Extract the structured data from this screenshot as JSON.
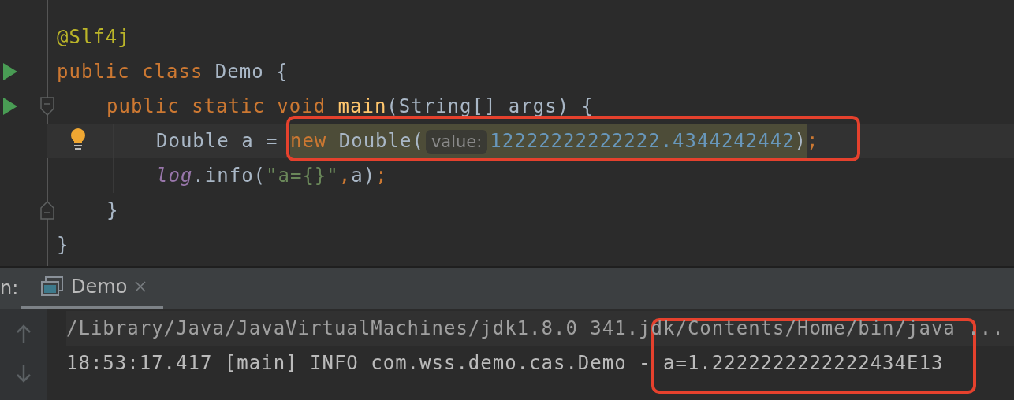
{
  "editor": {
    "lines": [
      {
        "run_marker": false,
        "current": false,
        "bulb": false,
        "tokens": [
          {
            "kind": "annotation",
            "text": "@Slf4j"
          }
        ]
      },
      {
        "run_marker": true,
        "current": false,
        "bulb": false,
        "tokens": [
          {
            "kind": "keyword",
            "text": "public class "
          },
          {
            "kind": "plain",
            "text": "Demo {"
          }
        ],
        "children": [
          {
            "run_marker": true,
            "current": false,
            "bulb": false,
            "kind": "block_start",
            "tokens": [
              {
                "kind": "keyword",
                "text": "public static void "
              },
              {
                "kind": "method",
                "text": "main"
              },
              {
                "kind": "plain",
                "text": "(String[] args) {"
              }
            ],
            "children": [
              {
                "run_marker": false,
                "current": true,
                "bulb": true,
                "tokens": [
                  {
                    "kind": "plain",
                    "text": "Double a = ",
                    "highlighted": false
                  },
                  {
                    "kind": "keyword",
                    "text": "new ",
                    "highlighted": true
                  },
                  {
                    "kind": "plain",
                    "text": "Double(",
                    "highlighted": true
                  },
                  {
                    "kind": "hint",
                    "text": "value:"
                  },
                  {
                    "kind": "number",
                    "text": "12222222222222.4344242442",
                    "highlighted": true
                  },
                  {
                    "kind": "plain",
                    "text": ")",
                    "highlighted": true
                  },
                  {
                    "kind": "keyword",
                    "text": ";",
                    "highlighted": false
                  }
                ]
              },
              {
                "run_marker": false,
                "current": false,
                "bulb": false,
                "tokens": [
                  {
                    "kind": "field",
                    "text": "log"
                  },
                  {
                    "kind": "plain",
                    "text": ".info("
                  },
                  {
                    "kind": "string",
                    "text": "\"a={}\""
                  },
                  {
                    "kind": "keyword",
                    "text": ","
                  },
                  {
                    "kind": "plain",
                    "text": "a)"
                  },
                  {
                    "kind": "keyword",
                    "text": ";"
                  }
                ]
              }
            ]
          },
          {
            "run_marker": false,
            "current": false,
            "bulb": false,
            "kind": "block_end",
            "tokens": [
              {
                "kind": "plain",
                "text": "}"
              }
            ]
          }
        ]
      },
      {
        "run_marker": false,
        "current": false,
        "bulb": false,
        "tokens": [
          {
            "kind": "plain",
            "text": "}"
          }
        ]
      }
    ]
  },
  "tool_window": {
    "label": "n:",
    "tabs": [
      {
        "label": "Demo",
        "selected": true
      }
    ],
    "console": {
      "lines": [
        {
          "kind": "command",
          "text": "/Library/Java/JavaVirtualMachines/jdk1.8.0_341.jdk/Contents/Home/bin/java ..."
        },
        {
          "kind": "output",
          "text": "18:53:17.417 [main] INFO com.wss.demo.cas.Demo - a=1.2222222222222434E13"
        }
      ]
    }
  }
}
